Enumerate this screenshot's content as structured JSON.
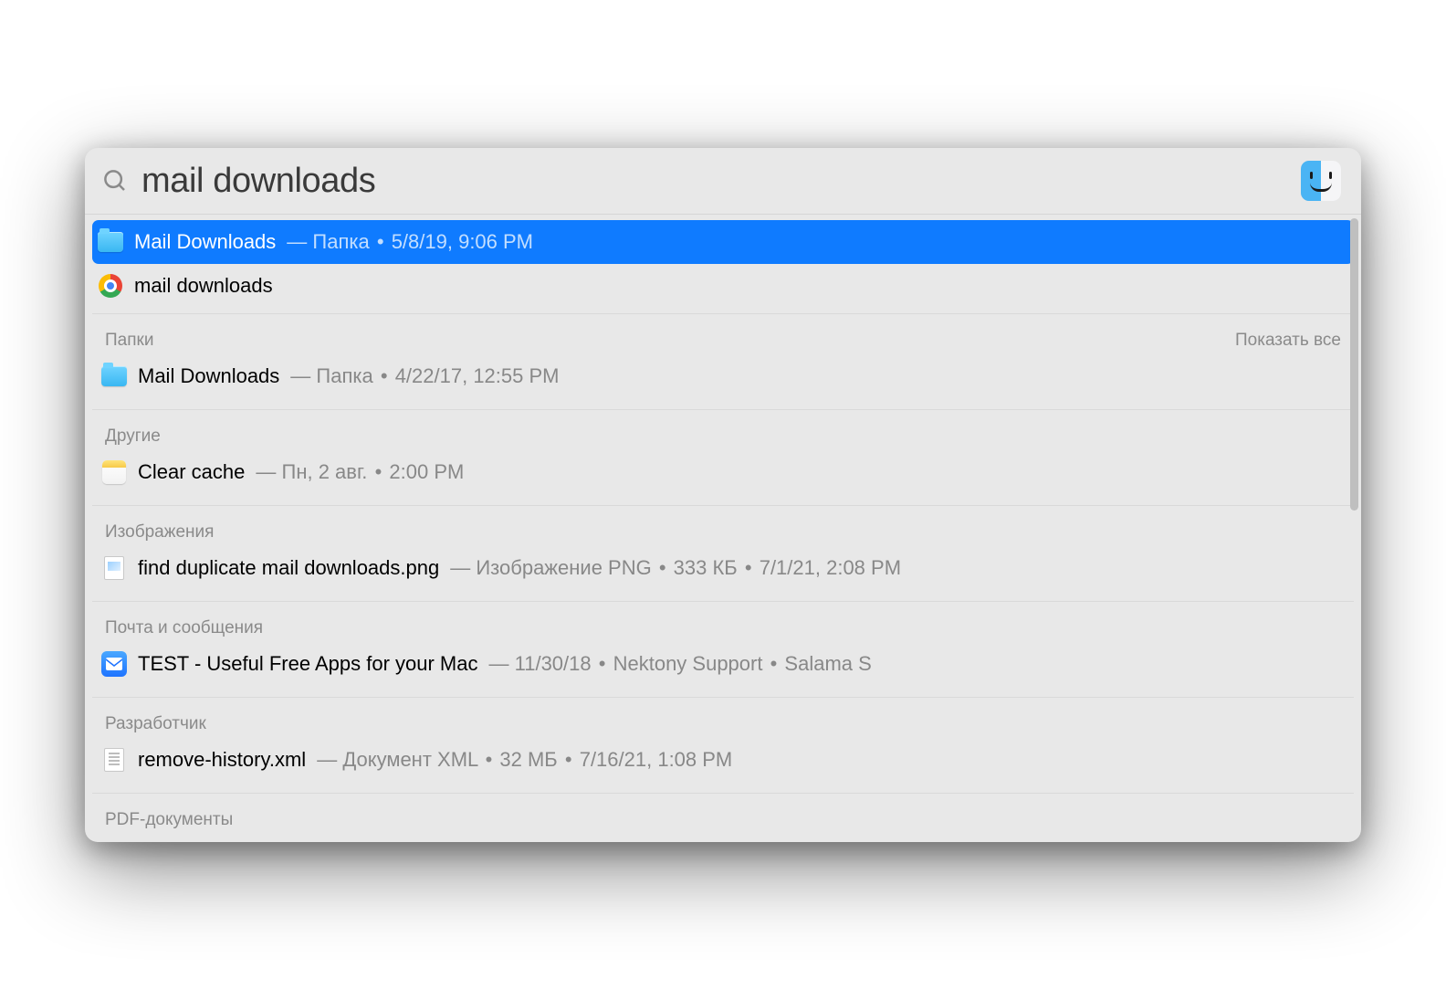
{
  "search": {
    "query": "mail downloads"
  },
  "topHit": {
    "title": "Mail Downloads",
    "kind": "Папка",
    "date": "5/8/19, 9:06 PM",
    "icon": "folder"
  },
  "suggestion": {
    "title": "mail downloads",
    "icon": "chrome"
  },
  "sections": [
    {
      "header": "Папки",
      "showAll": "Показать все",
      "items": [
        {
          "icon": "folder",
          "title": "Mail Downloads",
          "metaParts": [
            "Папка",
            "4/22/17, 12:55 PM"
          ]
        }
      ]
    },
    {
      "header": "Другие",
      "items": [
        {
          "icon": "note",
          "title": "Clear cache",
          "metaParts": [
            "Пн, 2 авг.",
            "2:00 PM"
          ]
        }
      ]
    },
    {
      "header": "Изображения",
      "items": [
        {
          "icon": "png",
          "title": "find duplicate mail downloads.png",
          "metaParts": [
            "Изображение PNG",
            "333 КБ",
            "7/1/21, 2:08 PM"
          ]
        }
      ]
    },
    {
      "header": "Почта и сообщения",
      "items": [
        {
          "icon": "mail",
          "title": "TEST - Useful Free Apps for your Mac",
          "metaParts": [
            "11/30/18",
            "Nektony Support",
            "Salama S"
          ]
        }
      ]
    },
    {
      "header": "Разработчик",
      "items": [
        {
          "icon": "xml",
          "title": "remove-history.xml",
          "metaParts": [
            "Документ XML",
            "32 МБ",
            "7/16/21, 1:08 PM"
          ]
        }
      ]
    },
    {
      "header": "PDF-документы",
      "items": []
    }
  ]
}
